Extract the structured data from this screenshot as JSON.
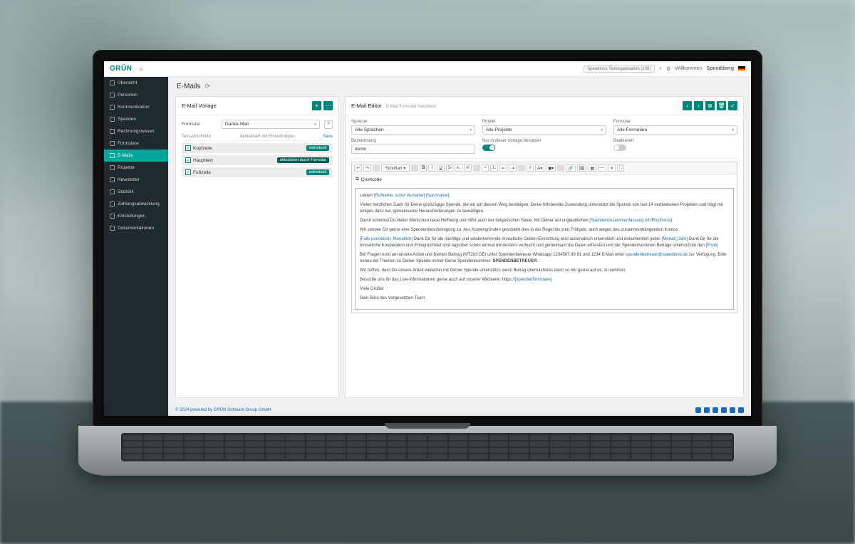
{
  "brand": "GRÜN",
  "topbar": {
    "search_placeholder": "Spendinos Testorganisation (100)",
    "user": "Spendiberg",
    "welcome": "Willkommen"
  },
  "sidebar": {
    "items": [
      {
        "label": "Übersicht"
      },
      {
        "label": "Personen"
      },
      {
        "label": "Kommunikation"
      },
      {
        "label": "Spenden"
      },
      {
        "label": "Rechnungswesen"
      },
      {
        "label": "Formulare"
      },
      {
        "label": "E-Mails"
      },
      {
        "label": "Projekte"
      },
      {
        "label": "Newsletter"
      },
      {
        "label": "Statistik"
      },
      {
        "label": "Zahlungsabwicklung"
      },
      {
        "label": "Einstellungen"
      },
      {
        "label": "Dokumentationen"
      }
    ],
    "active_index": 6
  },
  "page": {
    "title": "E-Mails"
  },
  "template_panel": {
    "title": "E-Mail Vorlage",
    "form_label": "Formular",
    "select_value": "Danke-Mail",
    "list_head_left": "Text-Abschnitte",
    "list_head_right": "Aktualisiert mit Einstellungen",
    "save_label": "Save",
    "sections": [
      {
        "name": "Kopfzeile",
        "badge": "individuell",
        "badge_class": ""
      },
      {
        "name": "Haupttext",
        "badge": "aktualisiert durch Formular",
        "badge_class": "dark"
      },
      {
        "name": "Fußzeile",
        "badge": "individuell",
        "badge_class": ""
      }
    ]
  },
  "editor_panel": {
    "title": "E-Mail Editor",
    "subtitle": "E-Mail Formular Haupttext",
    "fields": {
      "sprache": {
        "label": "Sprache",
        "value": "Alle Sprachen"
      },
      "projekt": {
        "label": "Projekt",
        "value": "Alle Projekte"
      },
      "formular": {
        "label": "Formular",
        "value": "Alle Formulare"
      },
      "bezeichnung": {
        "label": "Bezeichnung",
        "value": "demo"
      },
      "nurhier": {
        "label": "Nur in dieser Vorlage benutzen"
      },
      "deaktiviert": {
        "label": "Deaktiviert"
      }
    },
    "quellcode": "Quellcode",
    "body": {
      "p1_pre": "Liebe/r ",
      "p1_ph1": "[Rufname, sonst Vorname]",
      "p1_ph2": "[Nachname]",
      "p2": "Vielen herzlichen Dank für Deine großzügige Spende, die wir auf diesem Weg bestätigen. Deine hilfsbereite Zuwendung unterstützt die Spende von fast 14 verbliebenen Projekten und trägt mit einiges dazu bei, gemeinsame Herausforderungen zu bewältigen.",
      "p3_pre": "Damit schenkst Du vielen Menschen neue Hoffnung und hilfst auch der bulgarischen Seele. Mit Deiner auf unglaublichen ",
      "p3_ph": "[Spendenzusammenfassung mit Rhythmus]",
      "p4": "Wir senden Dir gerne eine Spendenbescheinigung zu. Aus Kostengründen geschieht dies in der Regel bis zum Frühjahr, auch wegen des zusammenhängenden Kontos.",
      "p5_pre": "",
      "p5_ph1": "[Falls periodisch: Monatlich]",
      "p5_mid": " Dank Dir für die nächtige und wiederkehrende monatliche Geben-Einrichtung wird automatisch erkenntlich und dokumentiert jeden ",
      "p5_ph2": "[Monat]",
      "p5_ph3": "[Jahr]",
      "p5_mid2": " Dank Dir für die monatliche Kooperation und Erfolgreichkeit sind tagsüber schon einmal mindestens verbucht und gemeinsam die Daten erfassten und der Spendensummen Beträge unterstützen den ",
      "p5_ph4": "[Ende]",
      "p6_pre": "Bei Fragen rund um unsere Arbeit und Deinen Beitrag (MT203 DE) unter Spendenbetreuer Whatsapp 1234567 89 81 und 1234 8-Mail unter ",
      "p6_ph": "spendenbetreuer@spendinos.de",
      "p6_post": " zur Verfügung. Bitte nenne bei Themen zu Deiner Spende immer Deine Spendennummer: ",
      "p6_strong": "SPENDENBETREUER",
      "p7": "Wir hoffen, dass Du unsere Arbeit weiterhin mit Deiner Spende unterstützt, wenn Betrag übernächstes dann so hör gerne auf es, zu nehmen.",
      "p8_pre": "Besuche uns für das Live-Informationen gerne auch auf unserer Webseite: https://",
      "p8_ph": "[spendenformulare]",
      "p9": "Viele Grüße!",
      "p10": "Dein Büro des Vorgesetzten-Team"
    }
  },
  "footer": {
    "copyright": "© 2024 powered by GRÜN Software Group GmbH"
  }
}
